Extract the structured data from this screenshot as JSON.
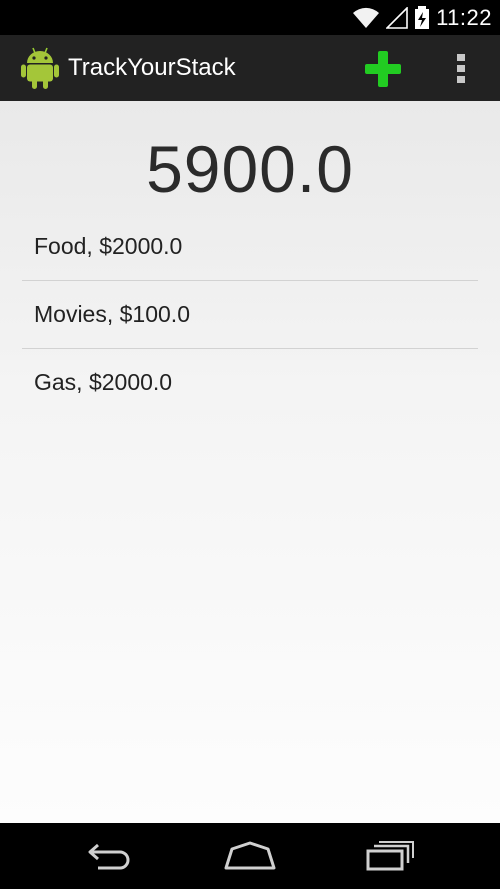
{
  "status_bar": {
    "time": "11:22",
    "icons": [
      "wifi-icon",
      "signal-icon",
      "battery-charging-icon"
    ]
  },
  "action_bar": {
    "app_icon": "android-icon",
    "title": "TrackYourStack",
    "actions": [
      "add-icon",
      "overflow-menu-icon"
    ],
    "add_color": "#22cc22"
  },
  "main": {
    "total": "5900.0",
    "items": [
      {
        "label": "Food, $2000.0"
      },
      {
        "label": "Movies, $100.0"
      },
      {
        "label": "Gas, $2000.0"
      }
    ]
  },
  "nav_bar": {
    "buttons": [
      "back-icon",
      "home-icon",
      "recent-apps-icon"
    ]
  }
}
